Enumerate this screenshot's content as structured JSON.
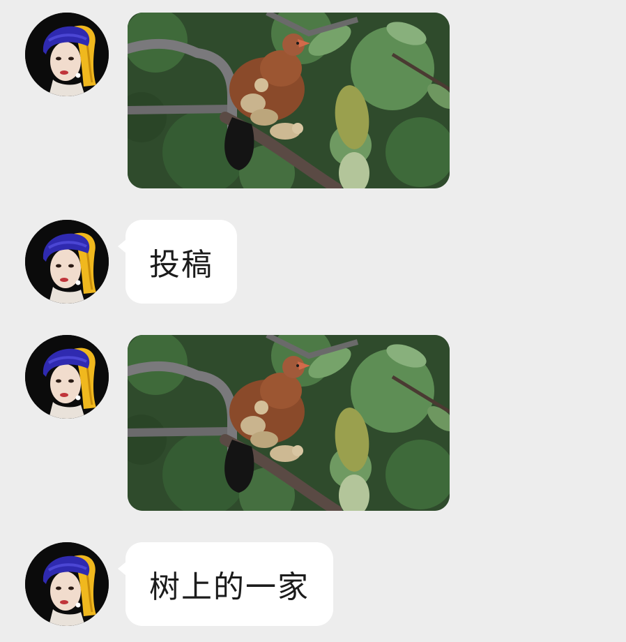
{
  "messages": [
    {
      "type": "image",
      "sender_avatar": "woman-with-blue-turban-avatar",
      "image": "hen-with-chicks-on-branch-photo"
    },
    {
      "type": "text",
      "sender_avatar": "woman-with-blue-turban-avatar",
      "text": "投稿"
    },
    {
      "type": "image",
      "sender_avatar": "woman-with-blue-turban-avatar",
      "image": "hen-with-chicks-on-branch-photo"
    },
    {
      "type": "text",
      "sender_avatar": "woman-with-blue-turban-avatar",
      "text": "树上的一家"
    }
  ],
  "colors": {
    "background": "#ededed",
    "bubble": "#ffffff",
    "text": "#1b1b1b",
    "turban_blue": "#2f2ab0",
    "turban_yellow": "#f0b81e"
  }
}
